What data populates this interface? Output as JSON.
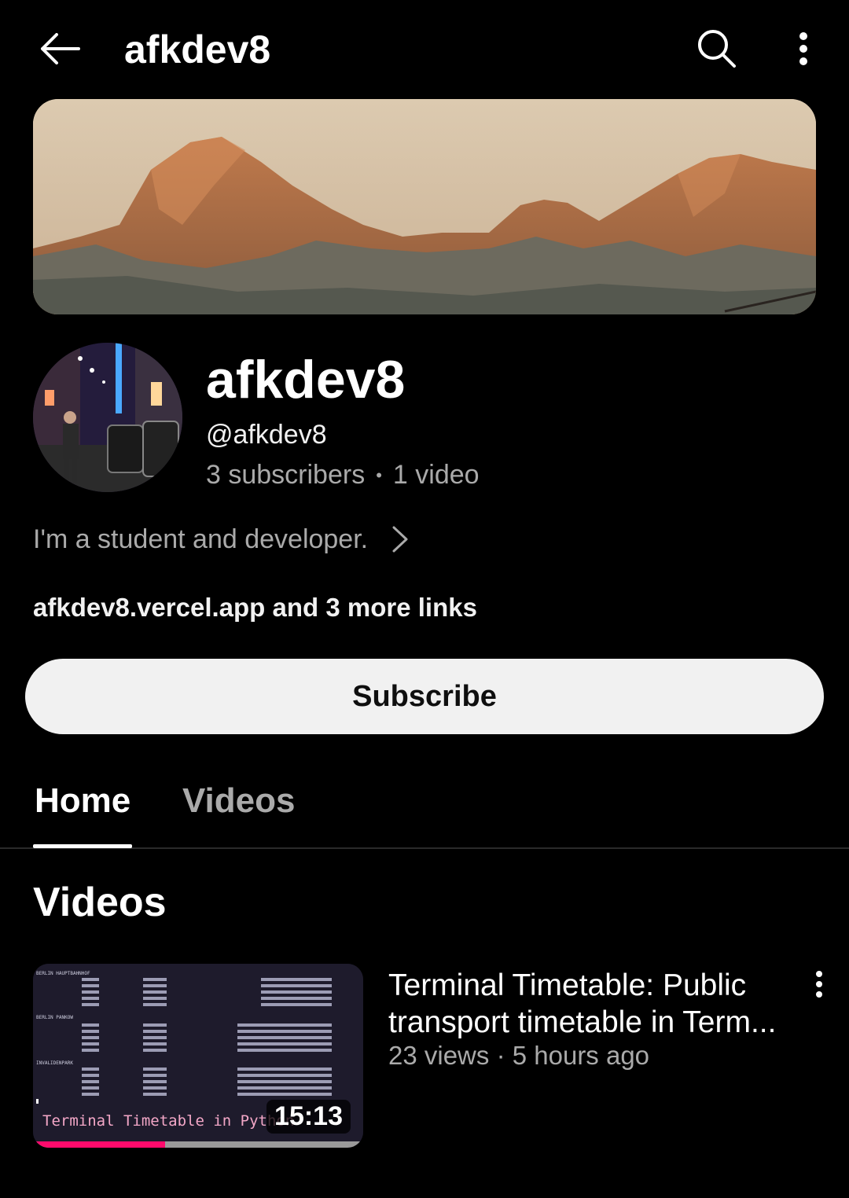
{
  "topbar": {
    "title": "afkdev8",
    "back_icon": "arrow-back-icon",
    "search_icon": "search-icon",
    "more_icon": "more-vert-icon"
  },
  "channel": {
    "name": "afkdev8",
    "handle": "@afkdev8",
    "subscribers": "3 subscribers",
    "separator": "•",
    "video_count": "1 video",
    "description": "I'm a student and developer.",
    "links": "afkdev8.vercel.app and 3 more links",
    "subscribe_label": "Subscribe"
  },
  "tabs": [
    {
      "label": "Home",
      "active": true
    },
    {
      "label": "Videos",
      "active": false
    }
  ],
  "section": {
    "title": "Videos"
  },
  "video": {
    "title": "Terminal Timetable: Public transport timetable in Term...",
    "views": "23 views",
    "meta_separator": "·",
    "age": "5 hours ago",
    "duration": "15:13",
    "watched_fraction": 0.4,
    "thumbnail_caption": "Terminal Timetable in Python"
  },
  "colors": {
    "background": "#000000",
    "text_primary": "#f1f1f1",
    "text_secondary": "#aaaaaa",
    "subscribe_bg": "#f1f1f1",
    "progress": "#ff0a6c"
  }
}
